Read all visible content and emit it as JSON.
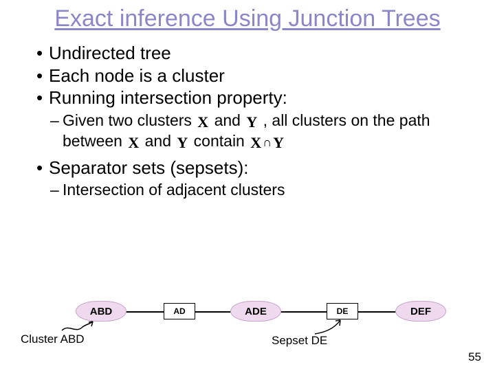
{
  "title": "Exact inference Using Junction Trees",
  "bullets": {
    "b1": "Undirected tree",
    "b2": "Each node is a cluster",
    "b3": "Running intersection property:",
    "b3_sub_pre": "Given two clusters ",
    "b3_sub_mid1": " and ",
    "b3_sub_mid2": " , all clusters on the path between ",
    "b3_sub_mid3": " and ",
    "b3_sub_mid4": " contain ",
    "b4": "Separator sets (sepsets):",
    "b4_sub": "Intersection of adjacent clusters"
  },
  "sym": {
    "X": "X",
    "Y": "Y",
    "cap": "∩"
  },
  "diagram": {
    "c1": "ABD",
    "s1": "AD",
    "c2": "ADE",
    "s2": "DE",
    "c3": "DEF",
    "ann_cluster": "Cluster ABD",
    "ann_sepset": "Sepset DE"
  },
  "page": "55"
}
